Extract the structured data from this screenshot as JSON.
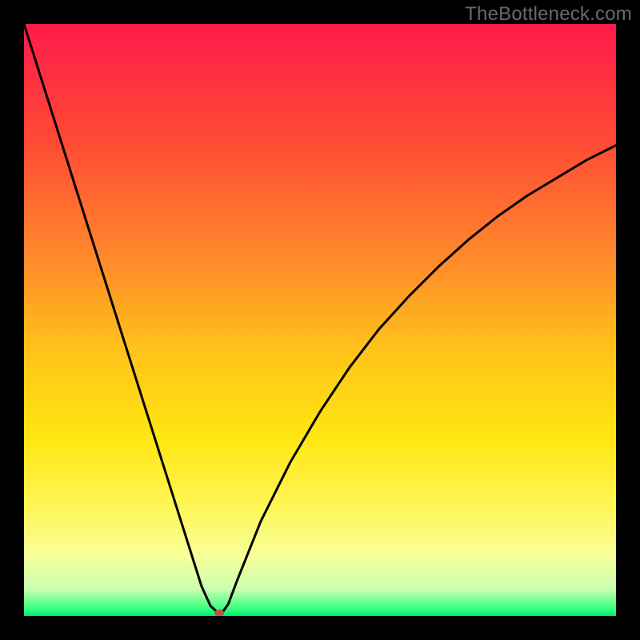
{
  "watermark": "TheBottleneck.com",
  "chart_data": {
    "type": "line",
    "title": "",
    "xlabel": "",
    "ylabel": "",
    "xlim": [
      0,
      100
    ],
    "ylim": [
      0,
      100
    ],
    "background": {
      "type": "vertical-gradient",
      "stops": [
        {
          "pos": 0.0,
          "color": "#ff1a49"
        },
        {
          "pos": 0.2,
          "color": "#ff4b35"
        },
        {
          "pos": 0.4,
          "color": "#ff8a2a"
        },
        {
          "pos": 0.55,
          "color": "#ffc21a"
        },
        {
          "pos": 0.7,
          "color": "#ffe611"
        },
        {
          "pos": 0.82,
          "color": "#fff65a"
        },
        {
          "pos": 0.9,
          "color": "#f6ff9a"
        },
        {
          "pos": 0.955,
          "color": "#c9ffb0"
        },
        {
          "pos": 0.99,
          "color": "#2eff7d"
        },
        {
          "pos": 1.0,
          "color": "#00e676"
        }
      ]
    },
    "series": [
      {
        "name": "bottleneck-curve",
        "color": "#000000",
        "x": [
          0,
          3,
          6,
          9,
          12,
          15,
          18,
          21,
          24,
          27,
          30,
          31.5,
          32.5,
          33,
          33.5,
          34.5,
          36,
          40,
          45,
          50,
          55,
          60,
          65,
          70,
          75,
          80,
          85,
          90,
          95,
          100
        ],
        "y": [
          100,
          90.5,
          81,
          71.5,
          62,
          52.5,
          43,
          33.5,
          24,
          14.5,
          5,
          1.7,
          0.8,
          0.5,
          0.6,
          2,
          6,
          16,
          26,
          34.5,
          42,
          48.5,
          54,
          59,
          63.5,
          67.5,
          71,
          74,
          77,
          79.5
        ]
      }
    ],
    "marker": {
      "name": "optimal-point",
      "x": 33,
      "y": 0.5,
      "color": "#b85a4a",
      "rx": 6,
      "ry": 4.5
    }
  }
}
